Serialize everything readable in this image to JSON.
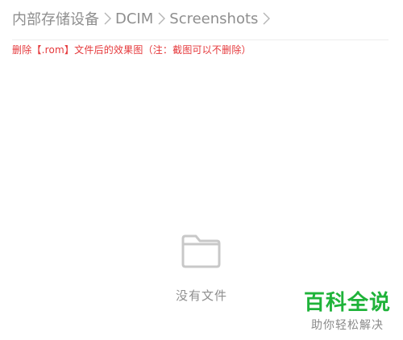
{
  "breadcrumb": {
    "items": [
      {
        "label": "内部存储设备"
      },
      {
        "label": "DCIM"
      },
      {
        "label": "Screenshots"
      }
    ],
    "separator_icon": "chevron-right-icon"
  },
  "annotation": {
    "text": "删除【.rom】文件后的效果图（注：截图可以不删除）",
    "color": "#e5383b"
  },
  "empty_state": {
    "icon": "folder-icon",
    "text": "没有文件"
  },
  "watermark": {
    "brand": "百科全说",
    "slogan": "助你轻松解决",
    "brand_color": "#1fb33a"
  }
}
